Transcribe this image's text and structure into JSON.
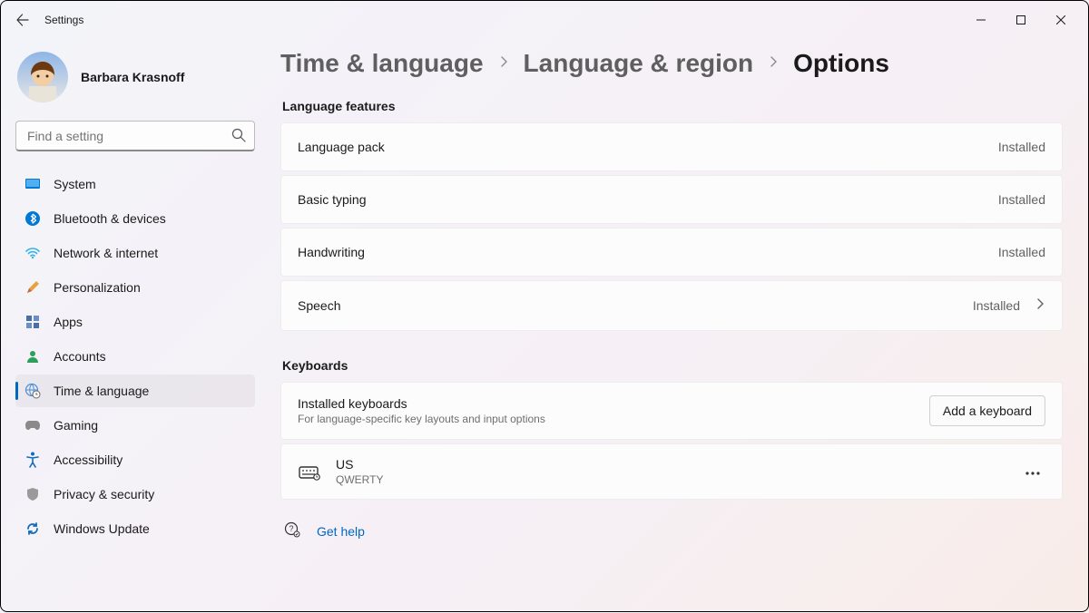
{
  "window": {
    "title": "Settings"
  },
  "user": {
    "name": "Barbara Krasnoff"
  },
  "search": {
    "placeholder": "Find a setting"
  },
  "nav": {
    "items": [
      {
        "id": "system",
        "label": "System"
      },
      {
        "id": "bluetooth",
        "label": "Bluetooth & devices"
      },
      {
        "id": "network",
        "label": "Network & internet"
      },
      {
        "id": "personalization",
        "label": "Personalization"
      },
      {
        "id": "apps",
        "label": "Apps"
      },
      {
        "id": "accounts",
        "label": "Accounts"
      },
      {
        "id": "time-language",
        "label": "Time & language"
      },
      {
        "id": "gaming",
        "label": "Gaming"
      },
      {
        "id": "accessibility",
        "label": "Accessibility"
      },
      {
        "id": "privacy",
        "label": "Privacy & security"
      },
      {
        "id": "update",
        "label": "Windows Update"
      }
    ],
    "selected_id": "time-language"
  },
  "breadcrumb": {
    "items": [
      "Time & language",
      "Language & region"
    ],
    "current": "Options"
  },
  "sections": {
    "language_features": {
      "title": "Language features",
      "rows": [
        {
          "label": "Language pack",
          "status": "Installed",
          "expandable": false
        },
        {
          "label": "Basic typing",
          "status": "Installed",
          "expandable": false
        },
        {
          "label": "Handwriting",
          "status": "Installed",
          "expandable": false
        },
        {
          "label": "Speech",
          "status": "Installed",
          "expandable": true
        }
      ]
    },
    "keyboards": {
      "title": "Keyboards",
      "header": {
        "title": "Installed keyboards",
        "subtitle": "For language-specific key layouts and input options",
        "add_label": "Add a keyboard"
      },
      "items": [
        {
          "name": "US",
          "layout": "QWERTY"
        }
      ]
    }
  },
  "help": {
    "label": "Get help"
  }
}
